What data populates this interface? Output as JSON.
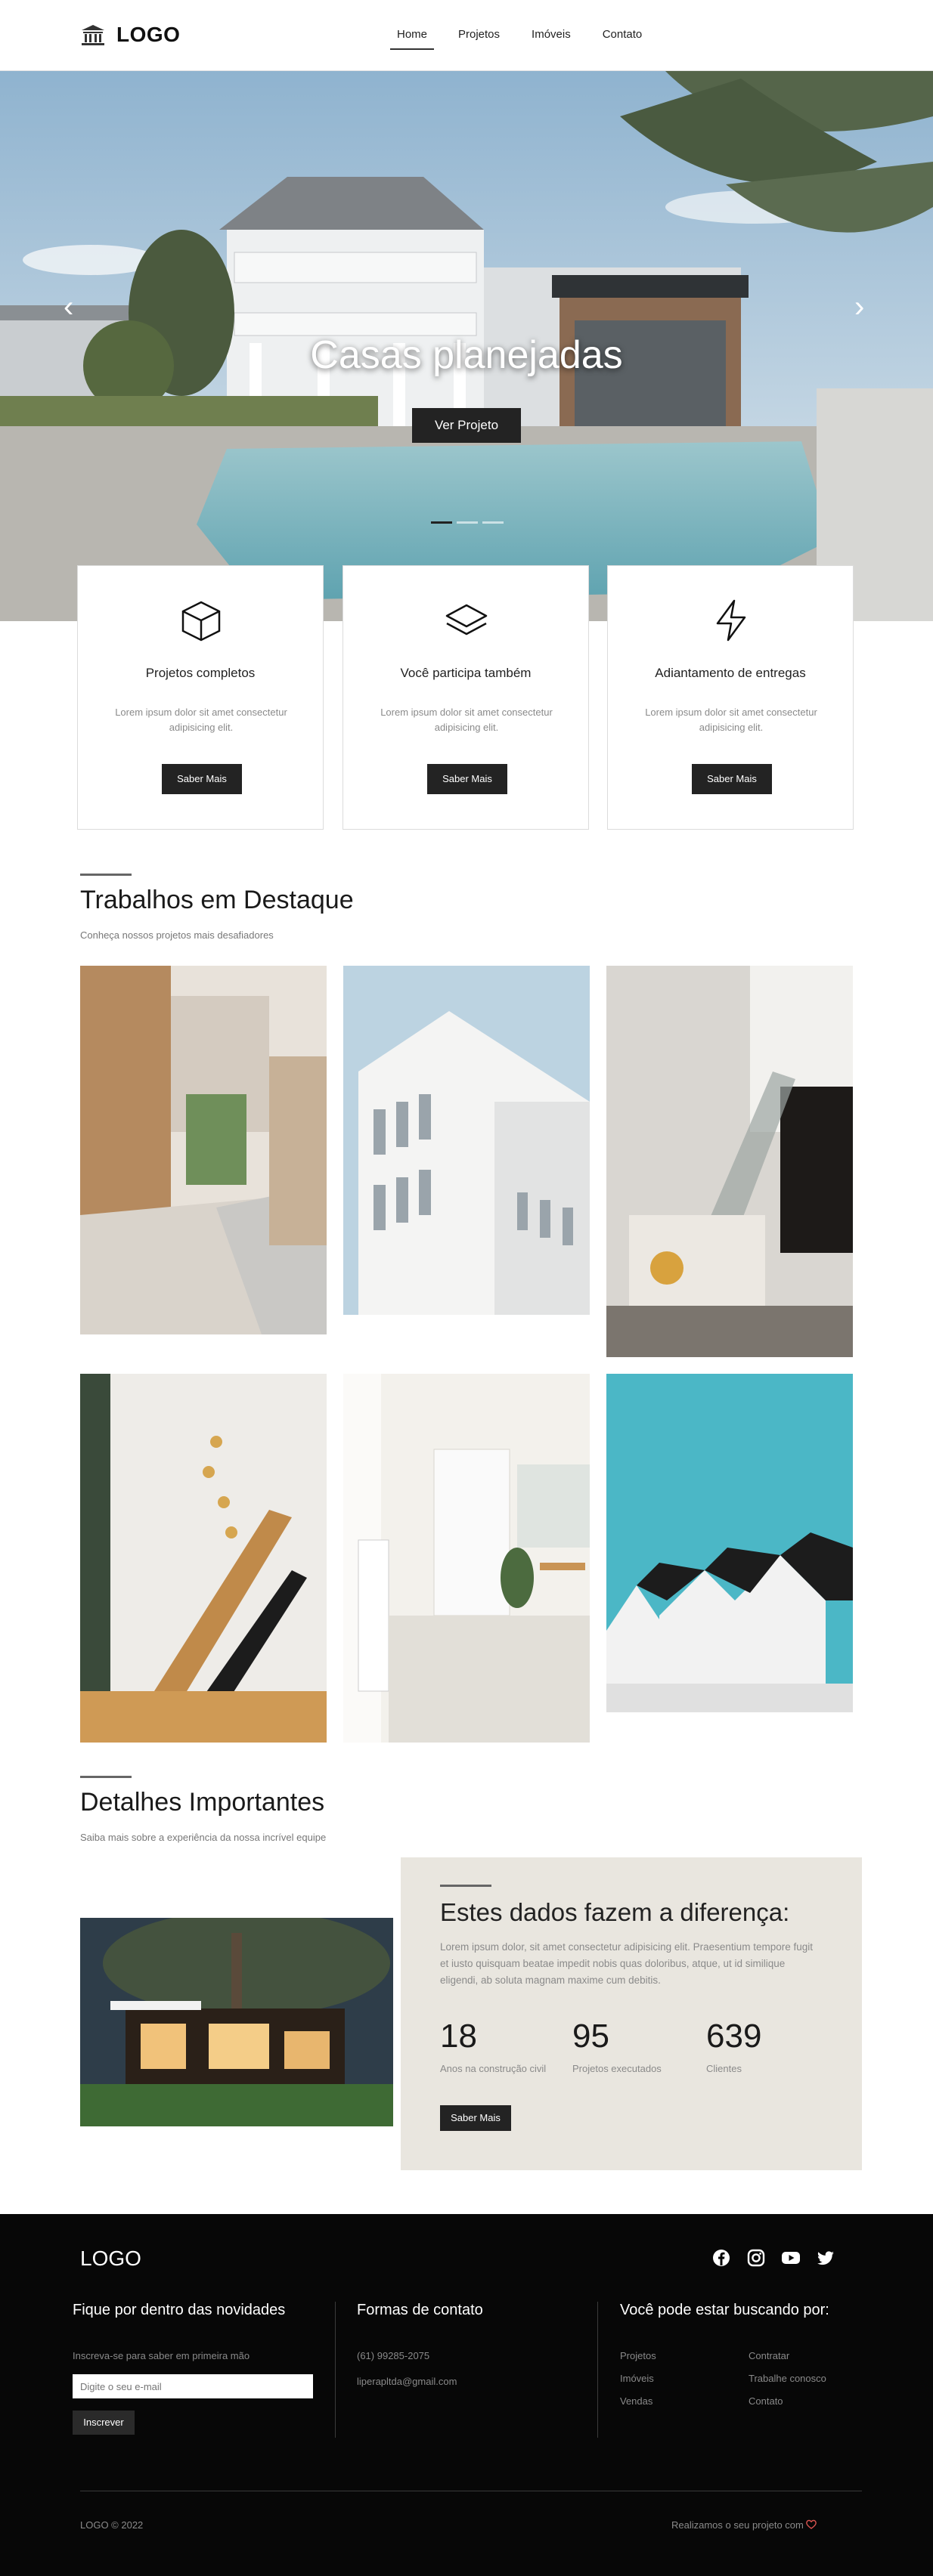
{
  "header": {
    "logo_text": "LOGO",
    "nav": [
      {
        "label": "Home",
        "active": true
      },
      {
        "label": "Projetos",
        "active": false
      },
      {
        "label": "Imóveis",
        "active": false
      },
      {
        "label": "Contato",
        "active": false
      }
    ]
  },
  "hero": {
    "title": "Casas planejadas",
    "button": "Ver Projeto",
    "slides_total": 3,
    "active_slide": 1
  },
  "features": [
    {
      "icon": "cube-icon",
      "title": "Projetos completos",
      "text": "Lorem ipsum dolor sit amet consectetur adipisicing elit.",
      "button": "Saber Mais"
    },
    {
      "icon": "layers-icon",
      "title": "Você participa também",
      "text": "Lorem ipsum dolor sit amet consectetur adipisicing elit.",
      "button": "Saber Mais"
    },
    {
      "icon": "lightning-icon",
      "title": "Adiantamento de entregas",
      "text": "Lorem ipsum dolor sit amet consectetur adipisicing elit.",
      "button": "Saber Mais"
    }
  ],
  "featured": {
    "title": "Trabalhos em Destaque",
    "subtitle": "Conheça nossos projetos mais desafiadores"
  },
  "details": {
    "title": "Detalhes Importantes",
    "subtitle": "Saiba mais sobre a experiência da nossa incrível equipe"
  },
  "stats": {
    "title": "Estes dados fazem a diferença:",
    "description": "Lorem ipsum dolor, sit amet consectetur adipisicing elit. Praesentium tempore fugit et iusto quisquam beatae impedit nobis quas doloribus, atque, ut id similique eligendi, ab soluta magnam maxime cum debitis.",
    "items": [
      {
        "number": "18",
        "label": "Anos na construção civil"
      },
      {
        "number": "95",
        "label": "Projetos executados"
      },
      {
        "number": "639",
        "label": "Clientes"
      }
    ],
    "button": "Saber Mais"
  },
  "footer": {
    "logo_text": "LOGO",
    "social": [
      "facebook-icon",
      "instagram-icon",
      "youtube-icon",
      "twitter-icon"
    ],
    "newsletter": {
      "title": "Fique por dentro das novidades",
      "text": "Inscreva-se para saber em primeira mão",
      "placeholder": "Digite o seu e-mail",
      "button": "Inscrever"
    },
    "contact": {
      "title": "Formas de contato",
      "phone": "(61) 99285-2075",
      "email": "liperapltda@gmail.com"
    },
    "links": {
      "title": "Você pode estar buscando por:",
      "col1": [
        "Projetos",
        "Imóveis",
        "Vendas"
      ],
      "col2": [
        "Contratar",
        "Trabalhe conosco",
        "Contato"
      ]
    },
    "copyright": "LOGO © 2022",
    "credit": "Realizamos o seu projeto com"
  },
  "colors": {
    "dark": "#232323",
    "stats_bg": "#e9e6df",
    "footer_bg": "#070707",
    "heart": "#d9534f"
  }
}
